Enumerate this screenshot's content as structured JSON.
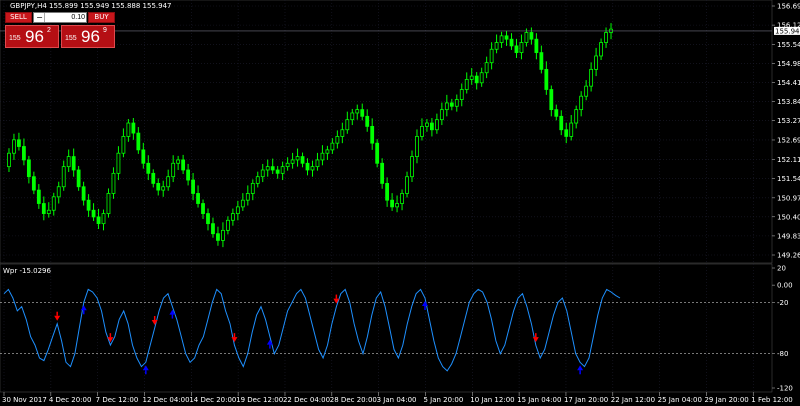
{
  "window": {
    "title": "GBPJPY,H4  155.899 155.949 155.888 155.947",
    "indicator_label": "Wpr -15.0296"
  },
  "trade_panel": {
    "sell_label": "SELL",
    "buy_label": "BUY",
    "lot_minus": "−",
    "lot_value": "0.10",
    "sell_quote": {
      "prefix": "155",
      "big": "96",
      "sup": "2"
    },
    "buy_quote": {
      "prefix": "155",
      "big": "96",
      "sup": "9"
    }
  },
  "colors": {
    "background": "#000000",
    "bull_candle": "#00ff00",
    "wpr_line": "#1e90ff",
    "price_line": "#6e6e7e",
    "sell_arrow": "#ff0000",
    "buy_arrow": "#0000ff",
    "level_line": "#c0c0c0",
    "grid": "#1c1c2c"
  },
  "chart_data": [
    {
      "type": "candlestick",
      "title": "GBPJPY,H4",
      "ylim": [
        149.265,
        156.69
      ],
      "y_ticks": [
        "156.690",
        "156.120",
        "155.947",
        "155.545",
        "154.980",
        "154.410",
        "153.840",
        "153.270",
        "152.695",
        "152.115",
        "151.545",
        "150.970",
        "150.405",
        "149.835",
        "149.265"
      ],
      "current_price": 155.947,
      "close_series": [
        151.9,
        152.3,
        152.7,
        152.5,
        152.1,
        151.6,
        151.2,
        150.8,
        150.5,
        150.6,
        151.0,
        151.3,
        151.9,
        152.2,
        151.8,
        151.3,
        150.9,
        150.6,
        150.4,
        150.2,
        150.5,
        151.1,
        151.7,
        152.3,
        152.8,
        153.2,
        152.9,
        152.4,
        152.0,
        151.7,
        151.4,
        151.2,
        151.3,
        151.6,
        152.0,
        152.1,
        151.8,
        151.5,
        151.1,
        150.8,
        150.5,
        150.2,
        149.9,
        149.7,
        150.0,
        150.3,
        150.5,
        150.7,
        150.9,
        151.1,
        151.4,
        151.6,
        151.8,
        151.9,
        151.8,
        151.7,
        151.9,
        152.0,
        152.1,
        152.2,
        152.0,
        151.8,
        151.9,
        152.1,
        152.3,
        152.4,
        152.6,
        152.8,
        153.0,
        153.3,
        153.5,
        153.6,
        153.4,
        153.1,
        152.6,
        152.0,
        151.4,
        150.9,
        150.7,
        150.8,
        151.1,
        151.6,
        152.2,
        152.8,
        153.1,
        153.2,
        153.0,
        153.3,
        153.6,
        153.8,
        153.7,
        153.9,
        154.2,
        154.5,
        154.6,
        154.4,
        154.7,
        155.0,
        155.4,
        155.6,
        155.8,
        155.7,
        155.5,
        155.3,
        155.6,
        155.9,
        155.7,
        155.3,
        154.8,
        154.2,
        153.6,
        153.4,
        153.0,
        152.8,
        153.2,
        153.6,
        154.0,
        154.3,
        154.8,
        155.2,
        155.6,
        155.9,
        156.0
      ],
      "x_ticks": [
        "30 Nov 2017",
        "4 Dec 20:00",
        "7 Dec 12:00",
        "12 Dec 04:00",
        "14 Dec 20:00",
        "19 Dec 12:00",
        "22 Dec 04:00",
        "28 Dec 20:00",
        "3 Jan 04:00",
        "5 Jan 20:00",
        "10 Jan 12:00",
        "15 Jan 04:00",
        "17 Jan 20:00",
        "22 Jan 12:00",
        "25 Jan 04:00",
        "29 Jan 20:00",
        "1 Feb 12:00"
      ]
    },
    {
      "type": "line",
      "title": "Wpr -15.0296",
      "ylim": [
        -120,
        20
      ],
      "y_ticks": [
        "20",
        "0.00",
        "-20",
        "-80",
        "-120"
      ],
      "levels": [
        -20,
        -80
      ],
      "series": [
        {
          "name": "Wpr",
          "values": [
            -10,
            -5,
            -15,
            -30,
            -25,
            -40,
            -60,
            -70,
            -85,
            -88,
            -75,
            -60,
            -45,
            -65,
            -90,
            -95,
            -80,
            -50,
            -20,
            -5,
            -8,
            -15,
            -30,
            -55,
            -70,
            -60,
            -40,
            -30,
            -45,
            -70,
            -85,
            -95,
            -90,
            -70,
            -50,
            -30,
            -15,
            -10,
            -25,
            -40,
            -60,
            -80,
            -90,
            -85,
            -70,
            -60,
            -40,
            -20,
            -5,
            -10,
            -30,
            -45,
            -70,
            -85,
            -95,
            -80,
            -55,
            -35,
            -25,
            -40,
            -60,
            -80,
            -70,
            -50,
            -30,
            -20,
            -10,
            -5,
            -15,
            -35,
            -55,
            -75,
            -85,
            -70,
            -45,
            -25,
            -10,
            -5,
            -20,
            -45,
            -65,
            -80,
            -60,
            -35,
            -15,
            -8,
            -25,
            -50,
            -75,
            -85,
            -70,
            -45,
            -25,
            -10,
            -5,
            -15,
            -40,
            -65,
            -85,
            -95,
            -100,
            -92,
            -80,
            -60,
            -40,
            -20,
            -10,
            -5,
            -8,
            -20,
            -40,
            -65,
            -80,
            -70,
            -50,
            -30,
            -15,
            -10,
            -25,
            -45,
            -70,
            -85,
            -75,
            -55,
            -35,
            -20,
            -15,
            -30,
            -55,
            -80,
            -90,
            -95,
            -85,
            -60,
            -35,
            -15,
            -5,
            -8,
            -12,
            -15
          ]
        }
      ],
      "sell_signals_index": [
        12,
        24,
        34,
        52,
        75,
        120
      ],
      "buy_signals_index": [
        18,
        32,
        38,
        60,
        95,
        130
      ]
    }
  ]
}
